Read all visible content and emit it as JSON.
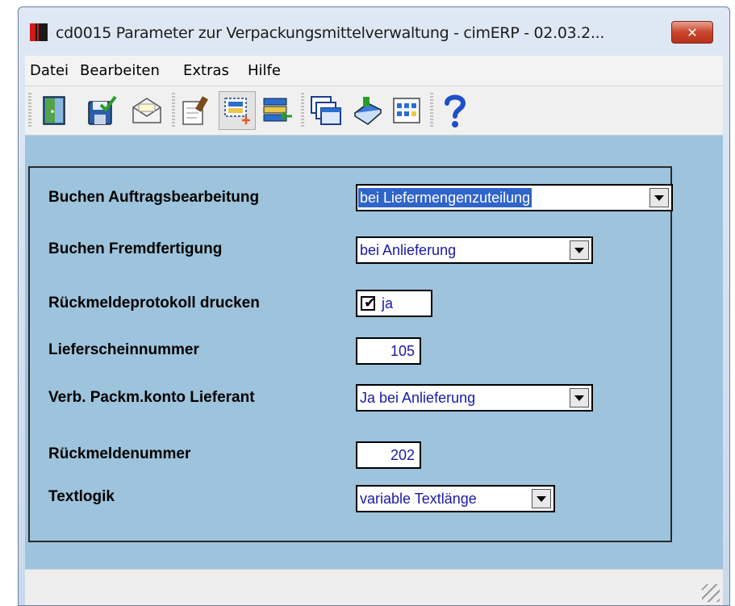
{
  "window": {
    "title": "cd0015 Parameter zur Verpackungsmittelverwaltung - cimERP - 02.03.2...",
    "close_label": "✕"
  },
  "menu": [
    "Datei",
    "Bearbeiten",
    "Extras",
    "Hilfe"
  ],
  "toolbar": {
    "icons": [
      "exit-door-icon",
      "save-icon",
      "mail-envelope-icon",
      "edit-document-icon",
      "new-record-icon",
      "transfer-list-icon",
      "windows-icon",
      "book-icon",
      "calendar-grid-icon",
      "help-question-icon"
    ]
  },
  "form": {
    "buchen_auftrag": {
      "label": "Buchen Auftragsbearbeitung",
      "value": "bei Liefermengenzuteilung"
    },
    "buchen_fremd": {
      "label": "Buchen Fremdfertigung",
      "value": "bei Anlieferung"
    },
    "rueckmeldeprotokoll": {
      "label": "Rückmeldeprotokoll drucken",
      "checked": true,
      "value": "ja"
    },
    "lieferscheinnummer": {
      "label": "Lieferscheinnummer",
      "value": "105"
    },
    "verb_packm": {
      "label": "Verb. Packm.konto Lieferant",
      "value": "Ja bei Anlieferung"
    },
    "rueckmeldenummer": {
      "label": "Rückmeldenummer",
      "value": "202"
    },
    "textlogik": {
      "label": "Textlogik",
      "value": "variable Textlänge"
    }
  }
}
